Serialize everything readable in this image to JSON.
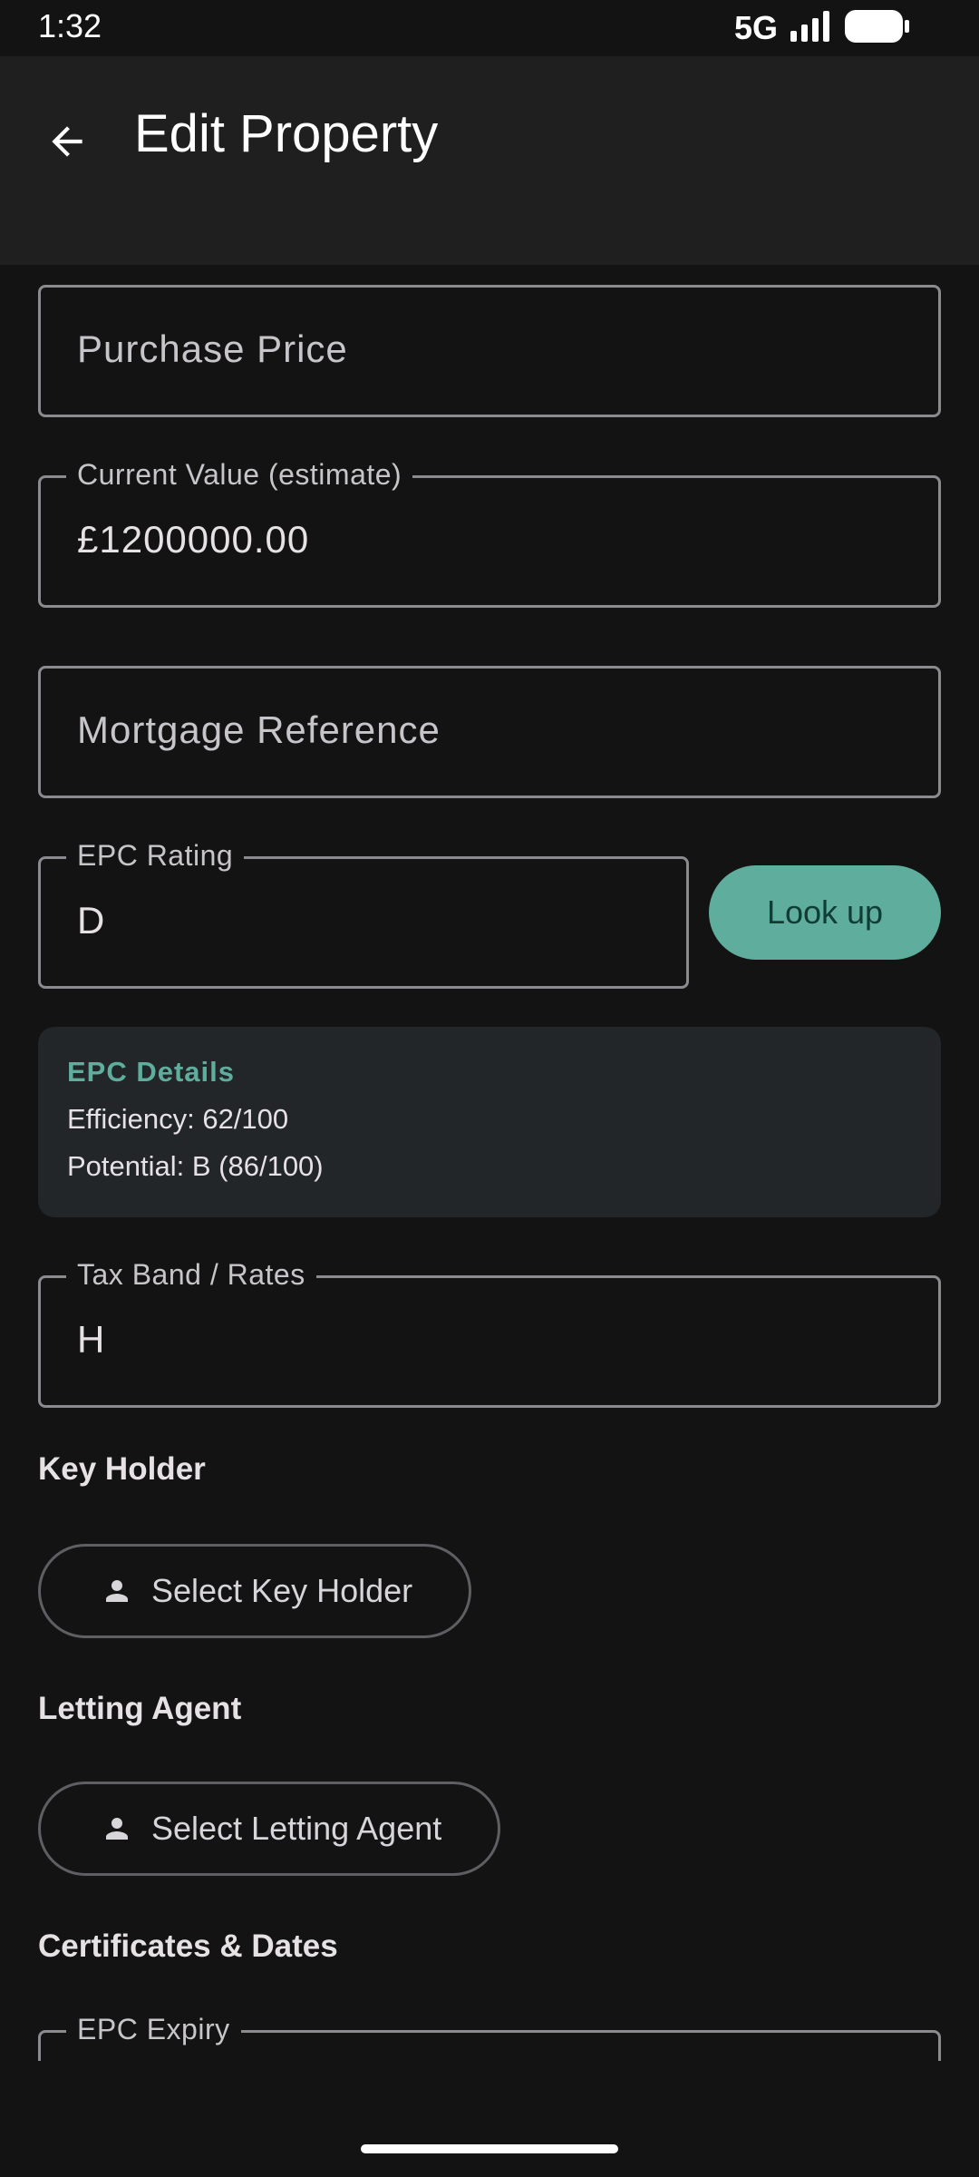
{
  "status_bar": {
    "time": "1:32",
    "network": "5G"
  },
  "app_bar": {
    "title": "Edit Property",
    "back_icon": "arrow-back-icon"
  },
  "form": {
    "purchase_price": {
      "placeholder": "Purchase Price"
    },
    "current_value": {
      "label": "Current Value (estimate)",
      "value": "£1200000.00"
    },
    "mortgage_reference": {
      "placeholder": "Mortgage Reference"
    },
    "epc_rating": {
      "label": "EPC Rating",
      "value": "D"
    },
    "lookup_label": "Look up",
    "epc_details": {
      "title": "EPC Details",
      "efficiency": "Efficiency: 62/100",
      "potential": "Potential: B (86/100)"
    },
    "tax_band": {
      "label": "Tax Band / Rates",
      "value": "H"
    },
    "key_holder": {
      "section_title": "Key Holder",
      "button_label": "Select Key Holder"
    },
    "letting_agent": {
      "section_title": "Letting Agent",
      "button_label": "Select Letting Agent"
    },
    "certificates": {
      "section_title": "Certificates & Dates",
      "epc_expiry_label": "EPC Expiry"
    }
  },
  "colors": {
    "accent": "#5fae9d",
    "background": "#131313",
    "app_bar": "#1f1f1f",
    "card": "#222628"
  }
}
